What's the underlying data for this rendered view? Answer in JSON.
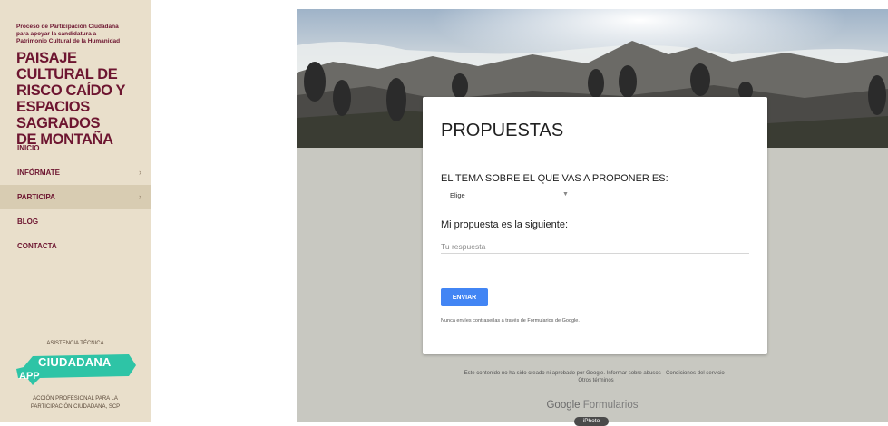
{
  "sidebar": {
    "subtitle_lines": [
      "Proceso de Participación Ciudadana",
      "para apoyar la candidatura a",
      "Patrimonio Cultural de la Humanidad"
    ],
    "title_lines": [
      "PAISAJE CULTURAL DE",
      "RISCO CAÍDO Y",
      "ESPACIOS SAGRADOS",
      "DE MONTAÑA"
    ],
    "nav_items": [
      {
        "label": "INICIO",
        "has_chevron": false,
        "active": false
      },
      {
        "label": "INFÓRMATE",
        "has_chevron": true,
        "active": false
      },
      {
        "label": "PARTICIPA",
        "has_chevron": true,
        "active": true
      },
      {
        "label": "BLOG",
        "has_chevron": false,
        "active": false
      },
      {
        "label": "CONTACTA",
        "has_chevron": false,
        "active": false
      }
    ],
    "chevron_glyph": "›",
    "assistance_label": "ASISTENCIA TÉCNICA",
    "logo": {
      "word1": "CIUDADANA",
      "word2": "APP",
      "color": "#2ec4a6"
    },
    "tagline_lines": [
      "ACCIÓN PROFESIONAL PARA LA",
      "PARTICIPACIÓN CIUDADANA, SCP"
    ]
  },
  "form": {
    "title": "PROPUESTAS",
    "question1": "EL TEMA SOBRE EL QUE VAS A PROPONER ES:",
    "select_value": "Elige",
    "select_arrow_glyph": "▼",
    "question2": "Mi propuesta es la siguiente:",
    "answer_placeholder": "Tu respuesta",
    "submit_label": "ENVIAR",
    "warning": "Nunca envíes contraseñas a través de Formularios de Google.",
    "footer_line1": "Este contenido no ha sido creado ni aprobado por Google. Informar sobre abusos - Condiciones del servicio -",
    "footer_line2": "Otros términos",
    "brand_google": "Google",
    "brand_forms": "Formularios",
    "badge": "iPhoto"
  },
  "colors": {
    "sidebar_bg": "#e9dfcb",
    "brand_maroon": "#6d1530",
    "form_bg": "#c8c8c1",
    "button_blue": "#4285f4"
  }
}
